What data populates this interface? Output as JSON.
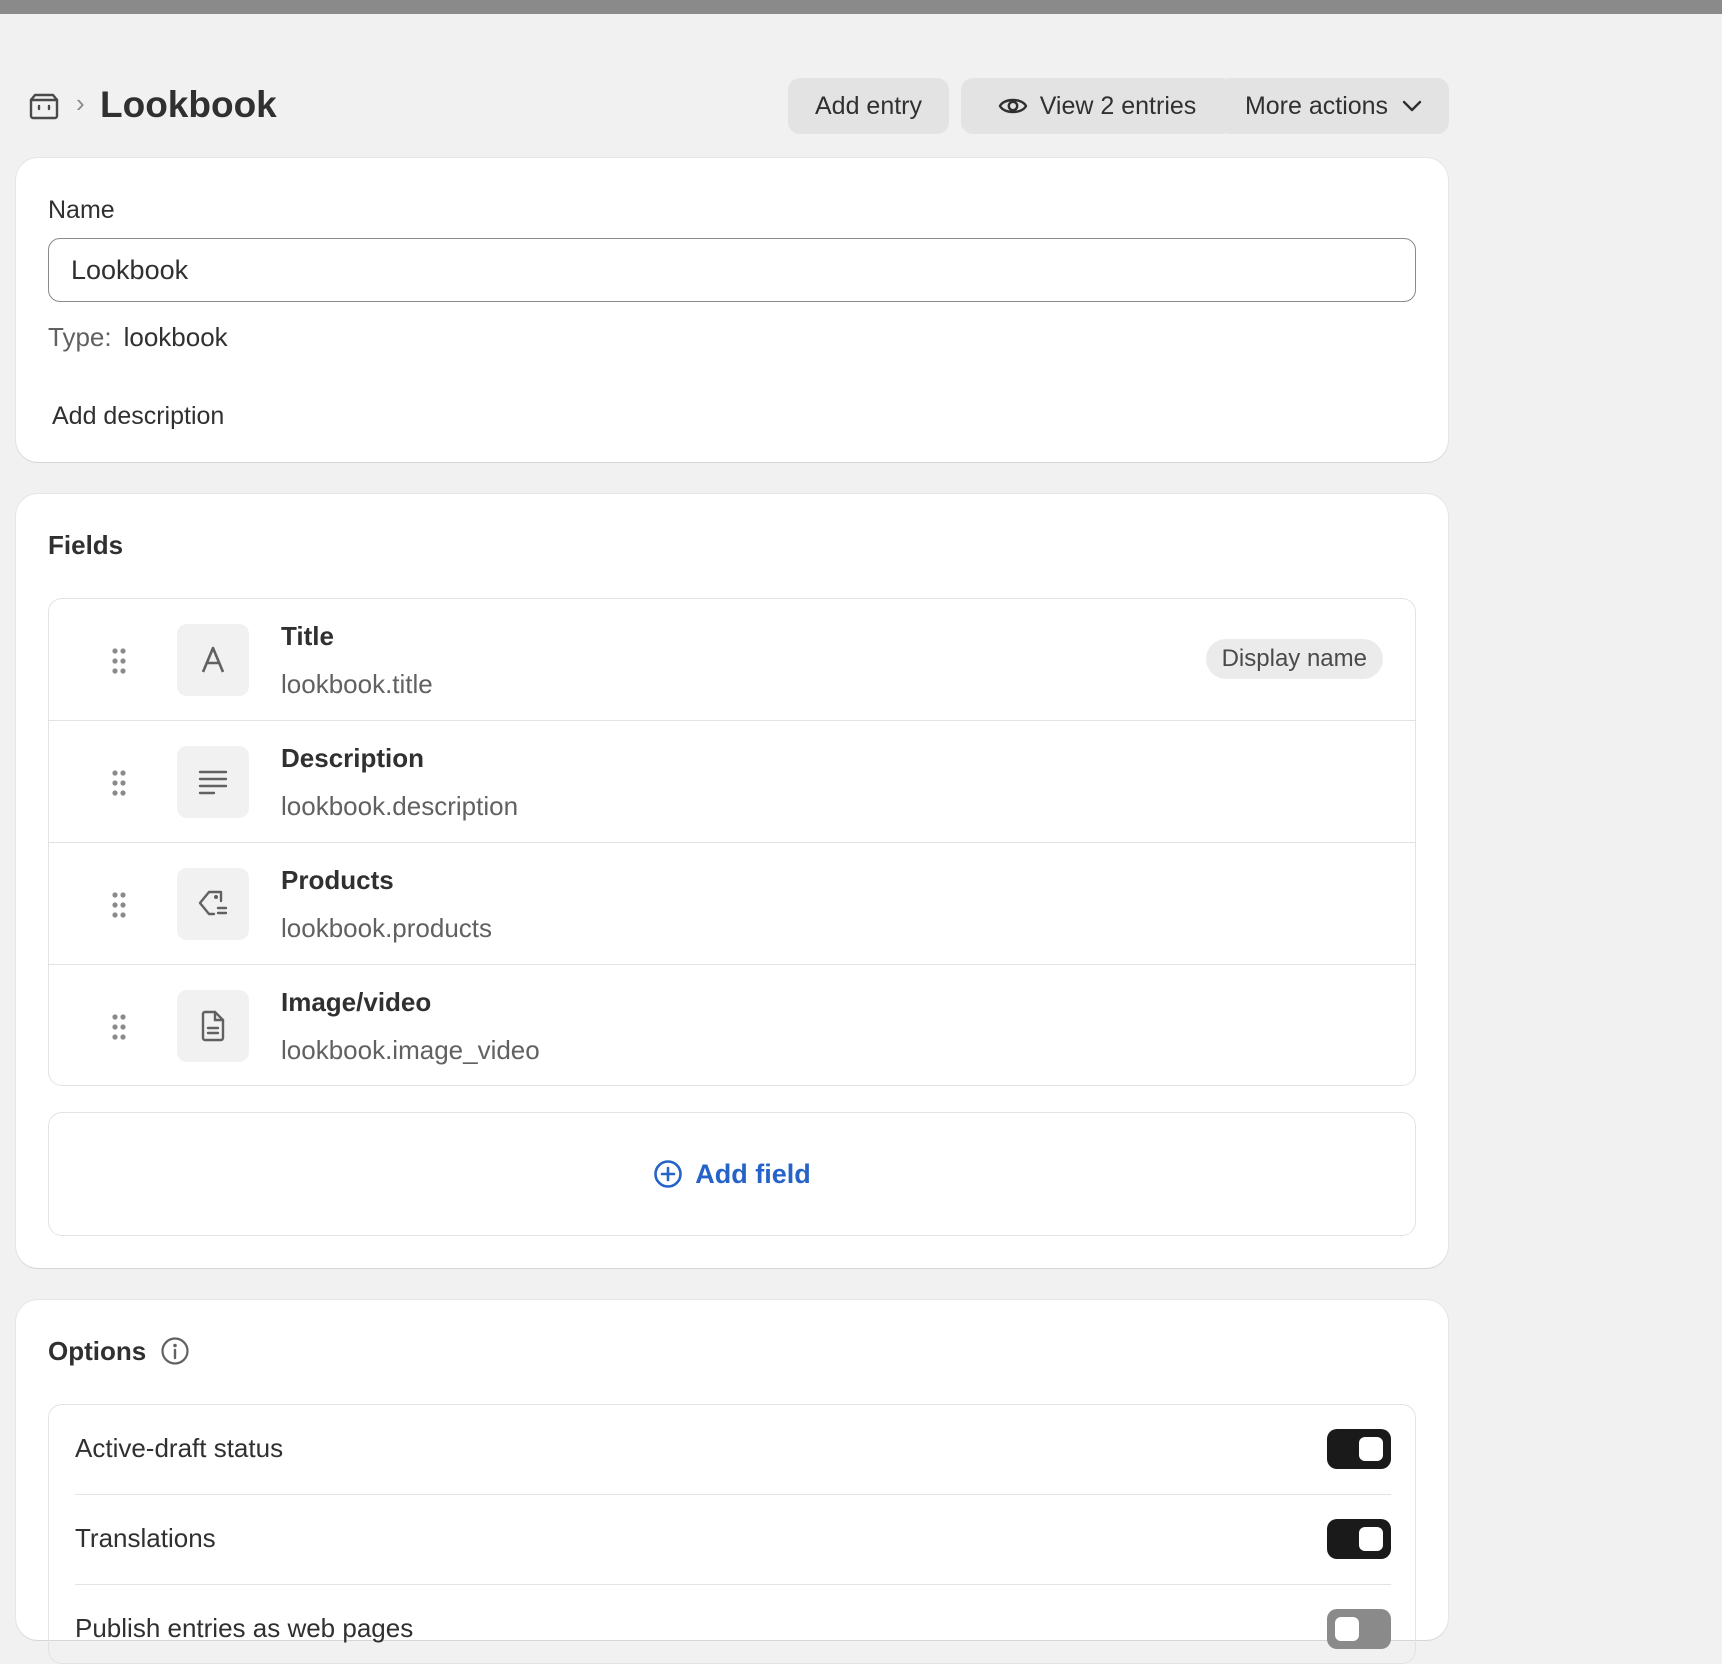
{
  "header": {
    "title": "Lookbook",
    "add_entry_label": "Add entry",
    "view_entries_label": "View 2 entries",
    "more_actions_label": "More actions"
  },
  "general": {
    "name_label": "Name",
    "name_value": "Lookbook",
    "type_label": "Type:",
    "type_value": "lookbook",
    "add_description_label": "Add description"
  },
  "fields": {
    "title": "Fields",
    "items": [
      {
        "name": "Title",
        "key": "lookbook.title",
        "icon": "text-icon",
        "badge": "Display name"
      },
      {
        "name": "Description",
        "key": "lookbook.description",
        "icon": "multiline-text-icon"
      },
      {
        "name": "Products",
        "key": "lookbook.products",
        "icon": "product-tag-icon"
      },
      {
        "name": "Image/video",
        "key": "lookbook.image_video",
        "icon": "file-icon"
      }
    ],
    "add_field_label": "Add field"
  },
  "options": {
    "title": "Options",
    "items": [
      {
        "label": "Active-draft status",
        "enabled": true
      },
      {
        "label": "Translations",
        "enabled": true
      },
      {
        "label": "Publish entries as web pages",
        "enabled": false
      }
    ]
  },
  "colors": {
    "accent_link": "#2563c9",
    "toggle_on": "#1a1a1a",
    "toggle_off": "#8a8a8a",
    "page_background": "#f1f1f1"
  }
}
